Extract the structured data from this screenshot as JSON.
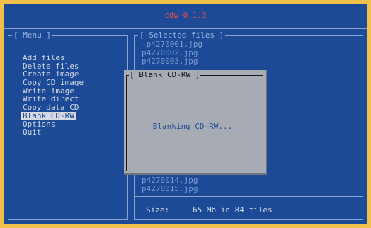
{
  "app": {
    "title": "cdw-0.1.3"
  },
  "menu": {
    "panel_title": "[ Menu ]",
    "items": [
      {
        "label": "Add files"
      },
      {
        "label": "Delete files"
      },
      {
        "label": "Create image"
      },
      {
        "label": "Copy CD image"
      },
      {
        "label": "Write image"
      },
      {
        "label": "Write direct"
      },
      {
        "label": "Copy data CD"
      },
      {
        "label": "Blank CD-RW",
        "selected": true
      },
      {
        "label": "Options"
      },
      {
        "label": "Quit"
      }
    ]
  },
  "files": {
    "panel_title": "[ Selected files ]",
    "visible_top": [
      "-p4270001.jpg",
      "p4270002.jpg",
      "p4270003.jpg"
    ],
    "visible_bottom": [
      "p4270014.jpg",
      "p4270015.jpg"
    ],
    "size_label": "Size:",
    "size_value": "65 Mb in 84 files"
  },
  "dialog": {
    "title": "[ Blank CD-RW ]",
    "message": "Blanking CD-RW..."
  },
  "colors": {
    "outer_border": "#f0c04a",
    "background": "#1c4a96",
    "title": "#e0524c",
    "file_text": "#7d9bd0",
    "dialog_bg": "#a7abb3"
  }
}
